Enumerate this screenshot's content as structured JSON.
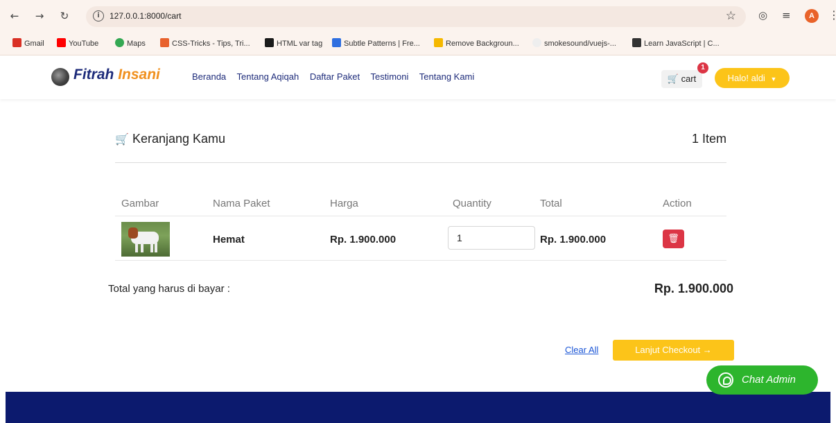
{
  "browser": {
    "url": "127.0.0.1:8000/cart",
    "profile_initial": "A",
    "bookmarks": [
      {
        "label": "Gmail",
        "color": "#d93025"
      },
      {
        "label": "YouTube",
        "color": "#ff0000"
      },
      {
        "label": "Maps",
        "color": "#34a853"
      },
      {
        "label": "CSS-Tricks - Tips, Tri...",
        "color": "#e8612c"
      },
      {
        "label": "HTML var tag",
        "color": "#1a1a1a"
      },
      {
        "label": "Subtle Patterns | Fre...",
        "color": "#2f6fe0"
      },
      {
        "label": "Remove Backgroun...",
        "color": "#f5b800"
      },
      {
        "label": "smokesound/vuejs-...",
        "color": "#dddddd"
      },
      {
        "label": "Learn JavaScript | C...",
        "color": "#333333"
      }
    ]
  },
  "navbar": {
    "logo_first": "Fitrah",
    "logo_second": "Insani",
    "menu": [
      "Beranda",
      "Tentang Aqiqah",
      "Daftar Paket",
      "Testimoni",
      "Tentang Kami"
    ],
    "cart_label": "cart",
    "cart_badge": "1",
    "user_label": "Halo! aldi"
  },
  "cart": {
    "title": "Keranjang Kamu",
    "item_count": "1 Item",
    "headers": [
      "Gambar",
      "Nama Paket",
      "Harga",
      "Quantity",
      "Total",
      "Action"
    ],
    "rows": [
      {
        "name": "Hemat",
        "price": "Rp. 1.900.000",
        "quantity": "1",
        "total": "Rp. 1.900.000"
      }
    ],
    "total_label": "Total yang harus di bayar :",
    "total_value": "Rp. 1.900.000",
    "clear_all": "Clear All",
    "checkout": "Lanjut Checkout →"
  },
  "chat": {
    "label": "Chat Admin"
  },
  "colors": {
    "brand_navy": "#1d2b7a",
    "brand_orange": "#f0901e",
    "accent_yellow": "#fcc419",
    "danger_red": "#dc3545",
    "whatsapp_green": "#2db52d",
    "footer_navy": "#0c1a6e"
  }
}
